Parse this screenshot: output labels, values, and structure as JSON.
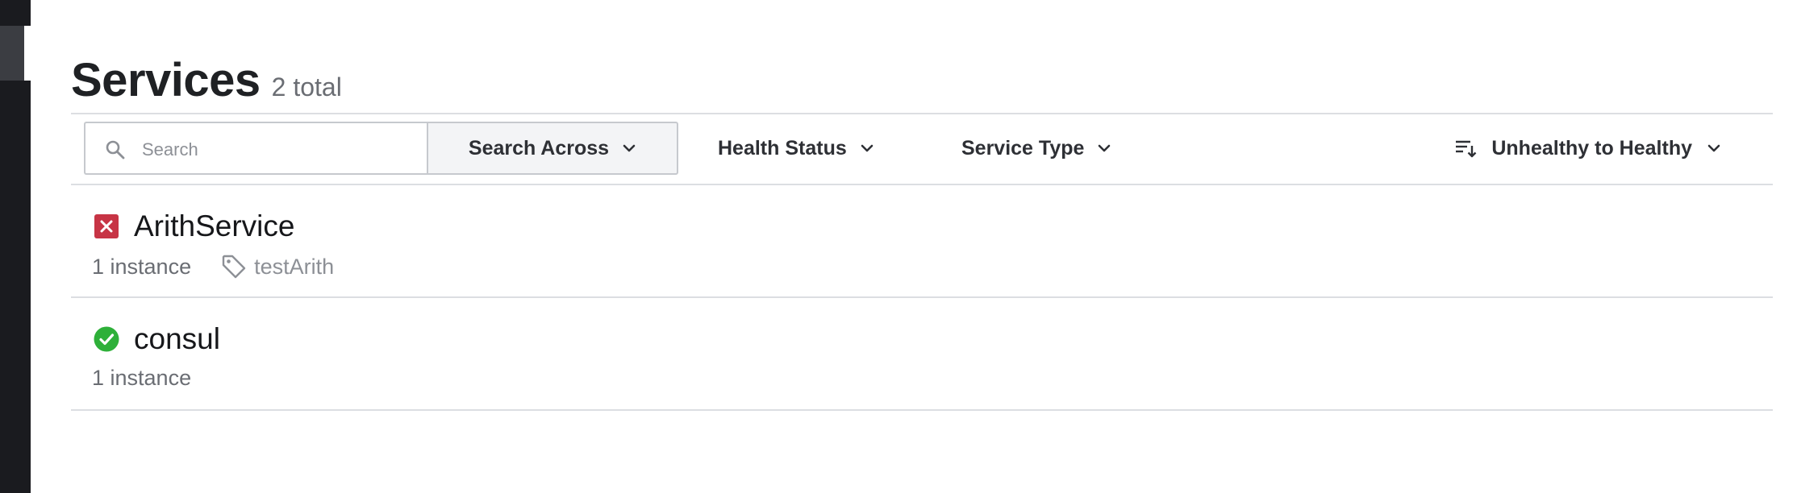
{
  "page": {
    "title": "Services",
    "count": "2 total"
  },
  "toolbar": {
    "search_placeholder": "Search",
    "search_across_label": "Search Across",
    "health_status_label": "Health Status",
    "service_type_label": "Service Type",
    "sort_label": "Unhealthy to Healthy"
  },
  "services": [
    {
      "name": "ArithService",
      "status": "critical",
      "status_icon": "critical-x-icon",
      "instances": "1 instance",
      "tags": [
        "testArith"
      ]
    },
    {
      "name": "consul",
      "status": "passing",
      "status_icon": "passing-check-icon",
      "instances": "1 instance",
      "tags": []
    }
  ],
  "colors": {
    "critical": "#c73445",
    "passing": "#2eb039",
    "sidebar": "#1a1b1f",
    "rule": "#dcdee2"
  }
}
